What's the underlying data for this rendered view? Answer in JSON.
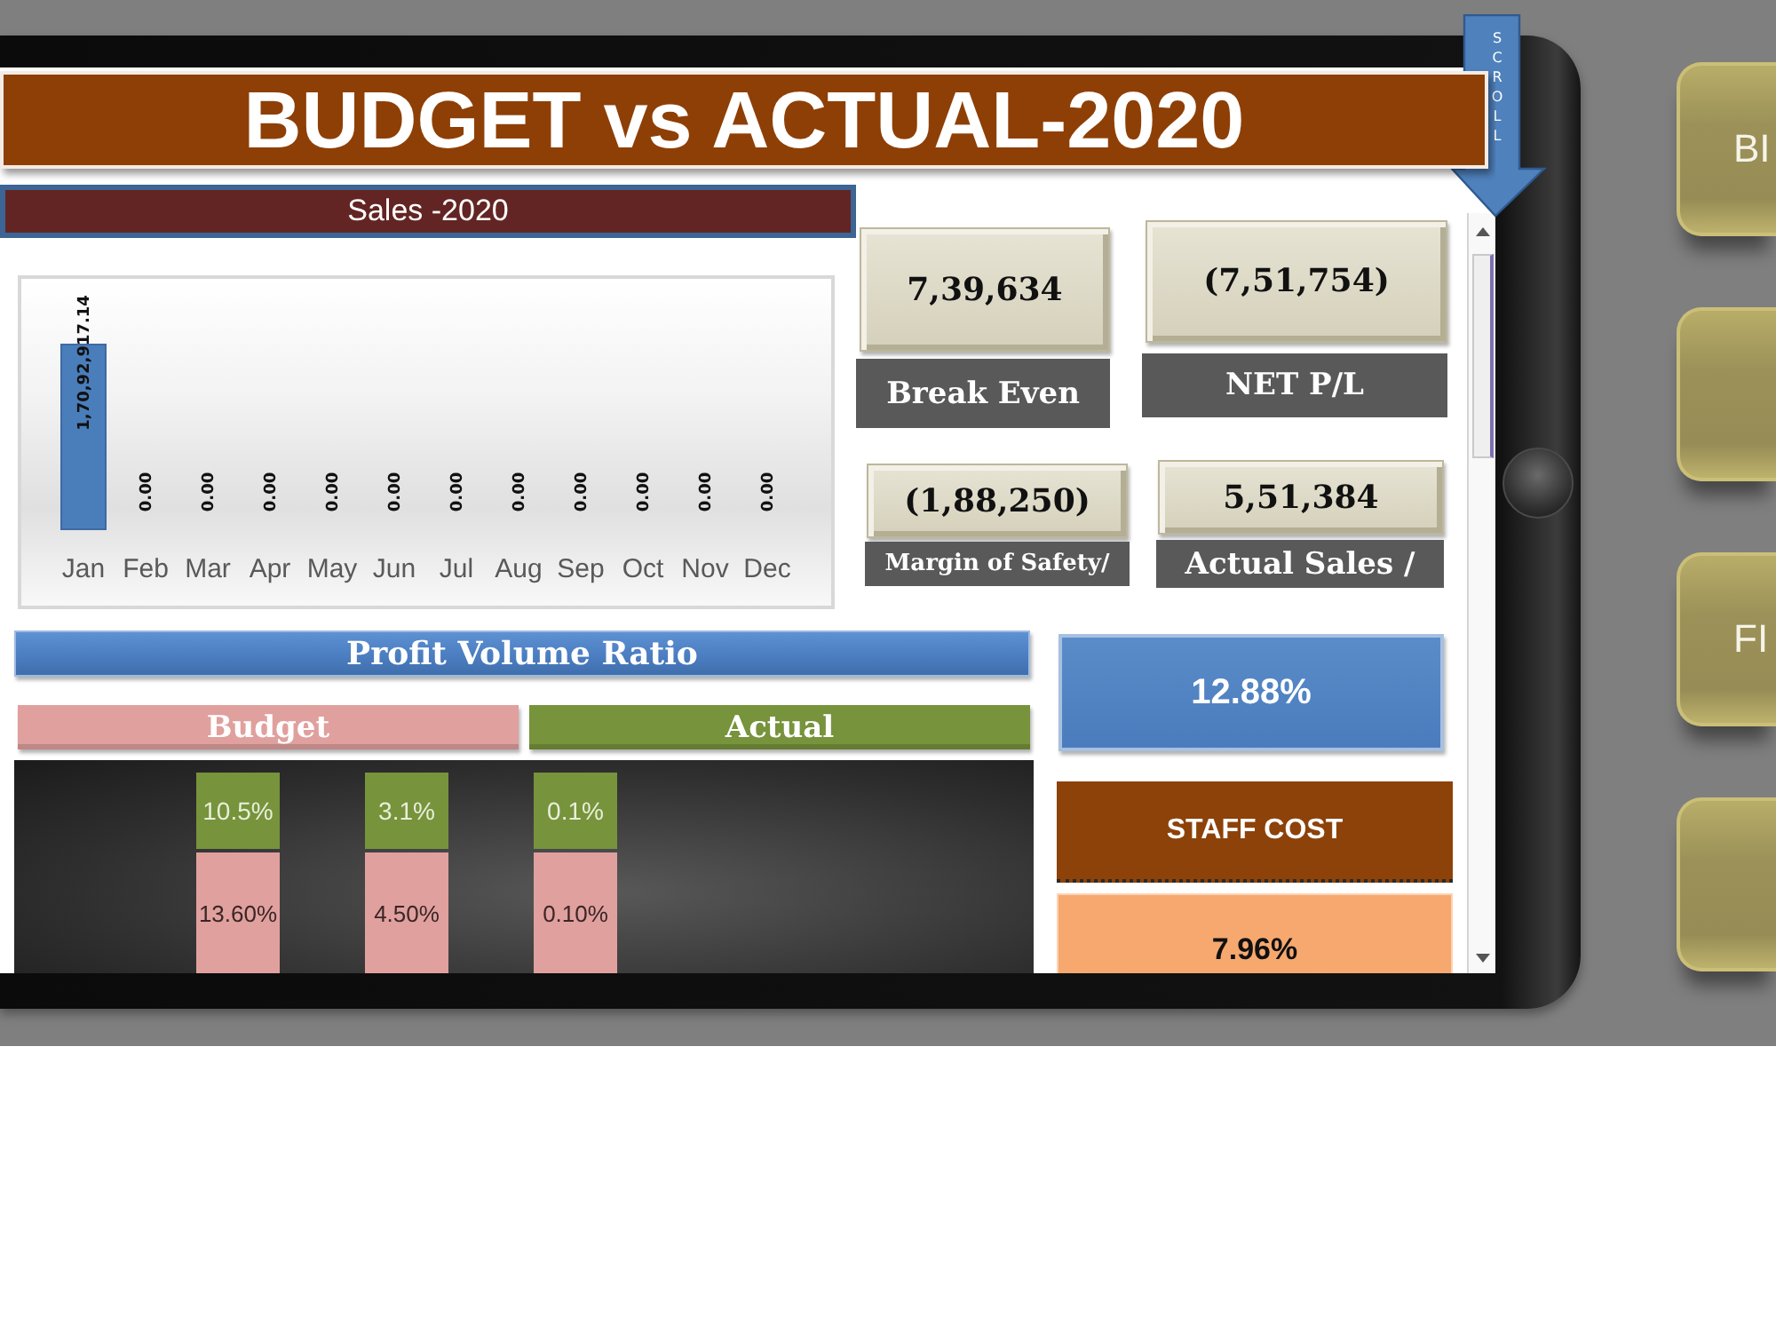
{
  "title": "BUDGET vs ACTUAL-2020",
  "scroll_hint": "SCROLL",
  "sales": {
    "title": "Sales -2020",
    "chart_data": {
      "type": "bar",
      "categories": [
        "Jan",
        "Feb",
        "Mar",
        "Apr",
        "May",
        "Jun",
        "Jul",
        "Aug",
        "Sep",
        "Oct",
        "Nov",
        "Dec"
      ],
      "values": [
        17092917.14,
        0,
        0,
        0,
        0,
        0,
        0,
        0,
        0,
        0,
        0,
        0
      ],
      "value_labels": [
        "1,70,92,917.14",
        "0.00",
        "0.00",
        "0.00",
        "0.00",
        "0.00",
        "0.00",
        "0.00",
        "0.00",
        "0.00",
        "0.00",
        "0.00"
      ]
    }
  },
  "kpis": [
    {
      "value": "7,39,634",
      "label": "Break Even"
    },
    {
      "value": "(7,51,754)",
      "label": "NET P/L"
    },
    {
      "value": "(1,88,250)",
      "label": "Margin of Safety/"
    },
    {
      "value": "5,51,384",
      "label": "Actual Sales /"
    }
  ],
  "profit_volume_ratio": {
    "title": "Profit Volume Ratio",
    "value": "12.88%",
    "legend": [
      {
        "label": "Budget",
        "color": "#e0a09e"
      },
      {
        "label": "Actual",
        "color": "#77933c"
      }
    ],
    "columns": [
      {
        "actual": "10.5%",
        "budget": "13.60%"
      },
      {
        "actual": "3.1%",
        "budget": "4.50%"
      },
      {
        "actual": "0.1%",
        "budget": "0.10%"
      }
    ]
  },
  "staff_cost": {
    "label": "STAFF COST",
    "value": "7.96%"
  },
  "nav_buttons": [
    {
      "kind": "text",
      "label": "BI"
    },
    {
      "kind": "blank"
    },
    {
      "kind": "text",
      "label": "FI"
    },
    {
      "kind": "blank"
    }
  ]
}
